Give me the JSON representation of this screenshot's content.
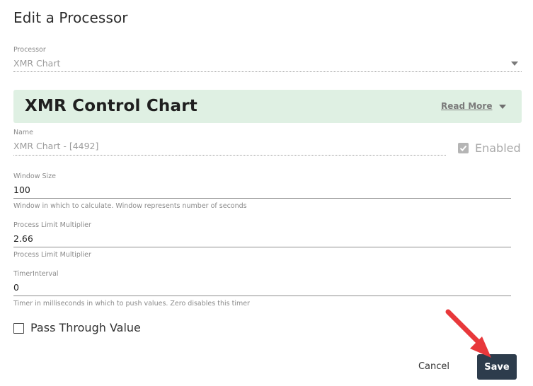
{
  "dialog": {
    "title": "Edit a Processor"
  },
  "processor": {
    "label": "Processor",
    "value": "XMR Chart"
  },
  "banner": {
    "title": "XMR Control Chart",
    "read_more": "Read More",
    "background": "#dff0e3"
  },
  "name": {
    "label": "Name",
    "value": "XMR Chart  - [4492]"
  },
  "enabled": {
    "label": "Enabled",
    "checked": true
  },
  "window_size": {
    "label": "Window Size",
    "value": "100",
    "helper": "Window in which to calculate. Window represents number of seconds"
  },
  "process_limit": {
    "label": "Process Limit Multiplier",
    "value": "2.66",
    "helper": "Process Limit Multiplier"
  },
  "timer_interval": {
    "label": "TimerInterval",
    "value": "0",
    "helper": "Timer in milliseconds in which to push values. Zero disables this timer"
  },
  "pass_through": {
    "label": "Pass Through Value",
    "checked": false
  },
  "actions": {
    "cancel": "Cancel",
    "save": "Save",
    "save_color": "#2d3c4c"
  },
  "annotation": {
    "arrow_color": "#e8383b",
    "arrow_icon": "red-arrow-icon"
  }
}
